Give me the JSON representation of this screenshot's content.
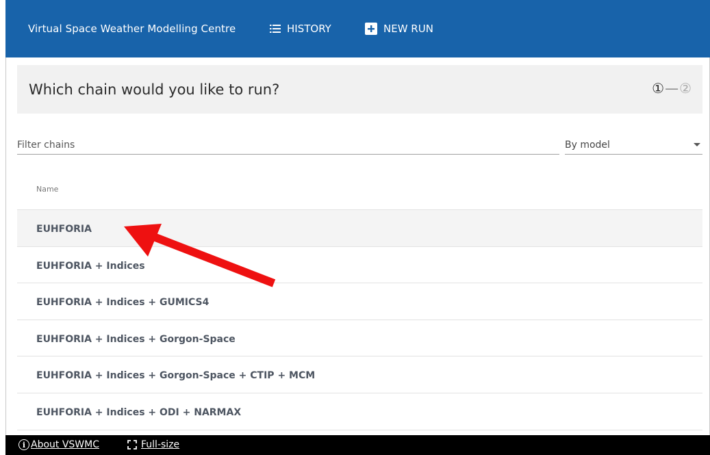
{
  "header": {
    "brand": "Virtual Space Weather Modelling Centre",
    "history_label": "HISTORY",
    "new_run_label": "NEW RUN"
  },
  "question": {
    "title": "Which chain would you like to run?",
    "step_current": "①",
    "step_separator": "—",
    "step_next": "②"
  },
  "filter": {
    "placeholder": "Filter chains"
  },
  "sort_select": {
    "value": "By model"
  },
  "table": {
    "column_name": "Name",
    "rows": [
      {
        "label": "EUHFORIA"
      },
      {
        "label": "EUHFORIA + Indices"
      },
      {
        "label": "EUHFORIA + Indices + GUMICS4"
      },
      {
        "label": "EUHFORIA + Indices + Gorgon-Space"
      },
      {
        "label": "EUHFORIA + Indices + Gorgon-Space + CTIP + MCM"
      },
      {
        "label": "EUHFORIA + Indices + ODI + NARMAX"
      }
    ]
  },
  "footer": {
    "about_label": "About VSWMC",
    "fullsize_label": "Full-size"
  },
  "colors": {
    "header_bg": "#1863aa",
    "footer_bg": "#000000",
    "annotation_arrow": "#ee1111"
  },
  "icons": [
    "list-icon",
    "plus-box-icon",
    "info-icon",
    "fullscreen-icon",
    "dropdown-caret-icon"
  ]
}
